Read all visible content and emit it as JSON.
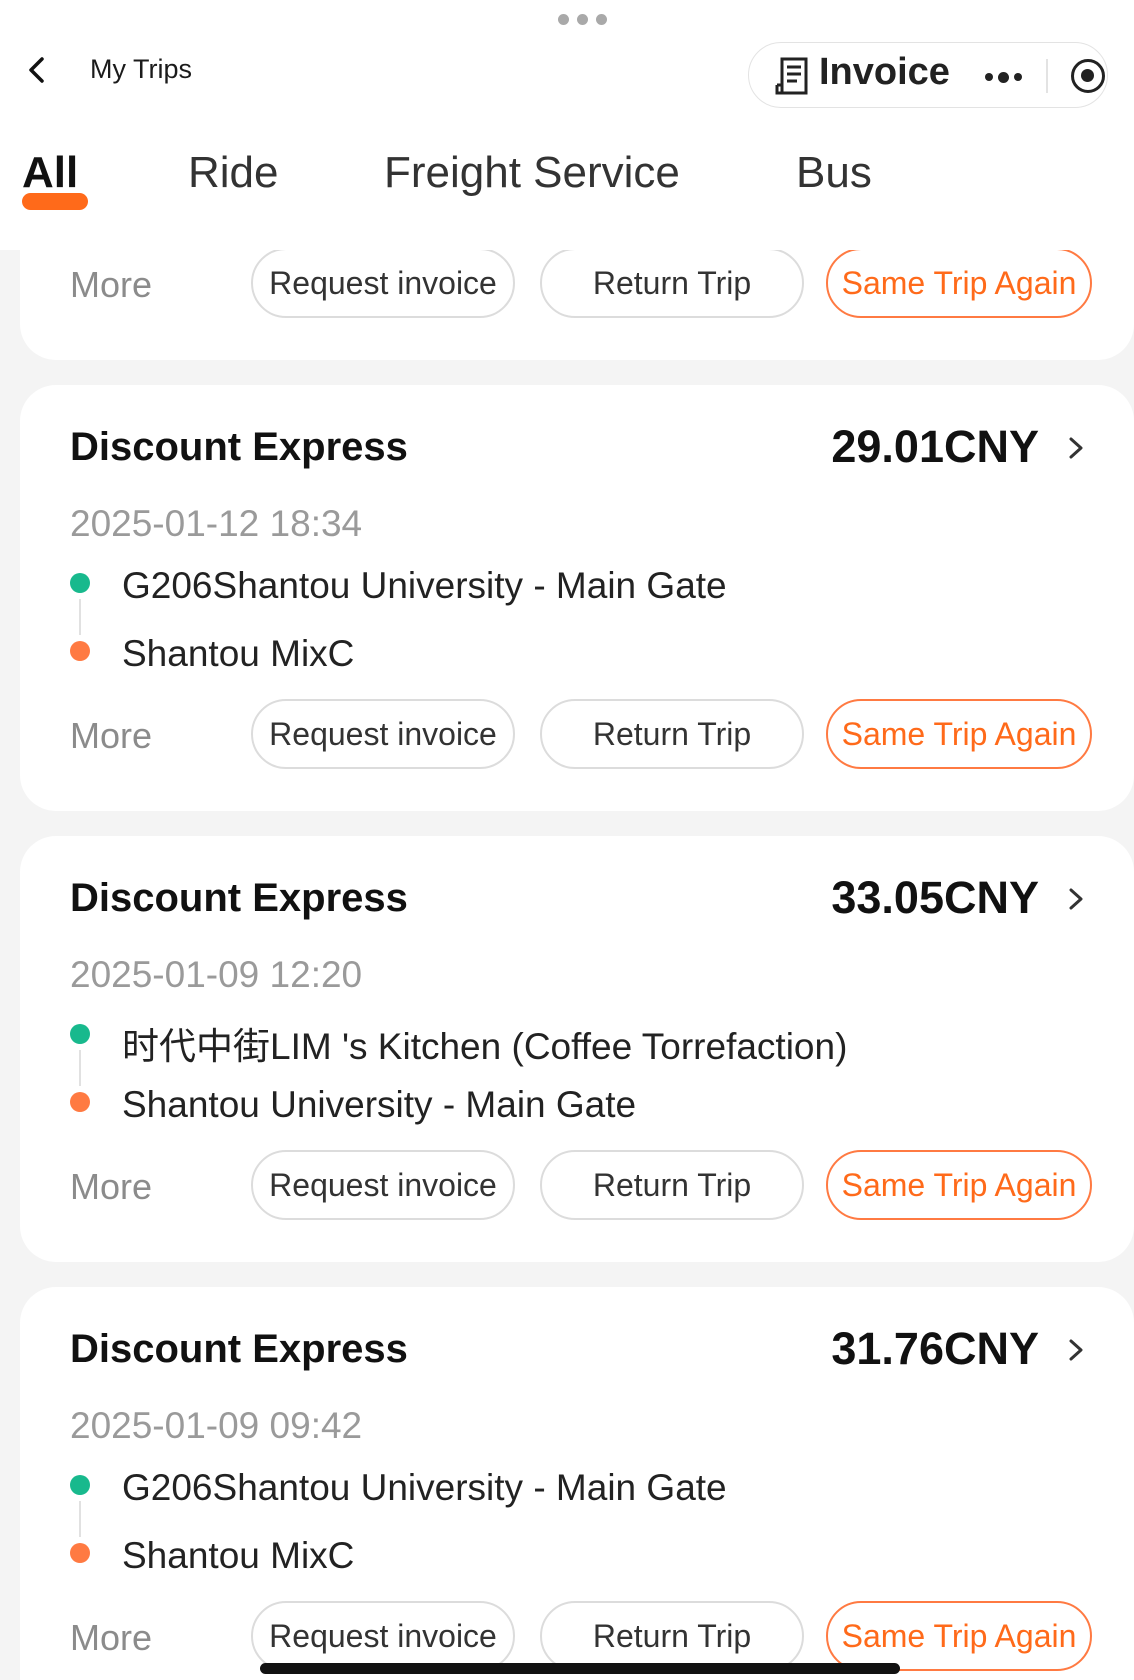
{
  "header": {
    "title": "My Trips",
    "invoice_label": "Invoice"
  },
  "tabs": [
    {
      "label": "All",
      "active": true
    },
    {
      "label": "Ride",
      "active": false
    },
    {
      "label": "Freight Service",
      "active": false
    },
    {
      "label": "Bus",
      "active": false
    }
  ],
  "colors": {
    "accent": "#ff6a1a",
    "start_dot": "#18b98d",
    "end_dot": "#ff7a42"
  },
  "actions": {
    "more": "More",
    "request_invoice": "Request invoice",
    "return_trip": "Return Trip",
    "same_trip_again": "Same Trip Again"
  },
  "trips": [
    {
      "title": "Discount Express",
      "price": "29.01CNY",
      "datetime": "2025-01-12 18:34",
      "from": "G206Shantou University - Main Gate",
      "to": "Shantou MixC"
    },
    {
      "title": "Discount Express",
      "price": "33.05CNY",
      "datetime": "2025-01-09 12:20",
      "from": "时代中街LIM 's Kitchen (Coffee Torrefaction)",
      "to": "Shantou University - Main Gate"
    },
    {
      "title": "Discount Express",
      "price": "31.76CNY",
      "datetime": "2025-01-09 09:42",
      "from": "G206Shantou University - Main Gate",
      "to": "Shantou MixC"
    }
  ]
}
